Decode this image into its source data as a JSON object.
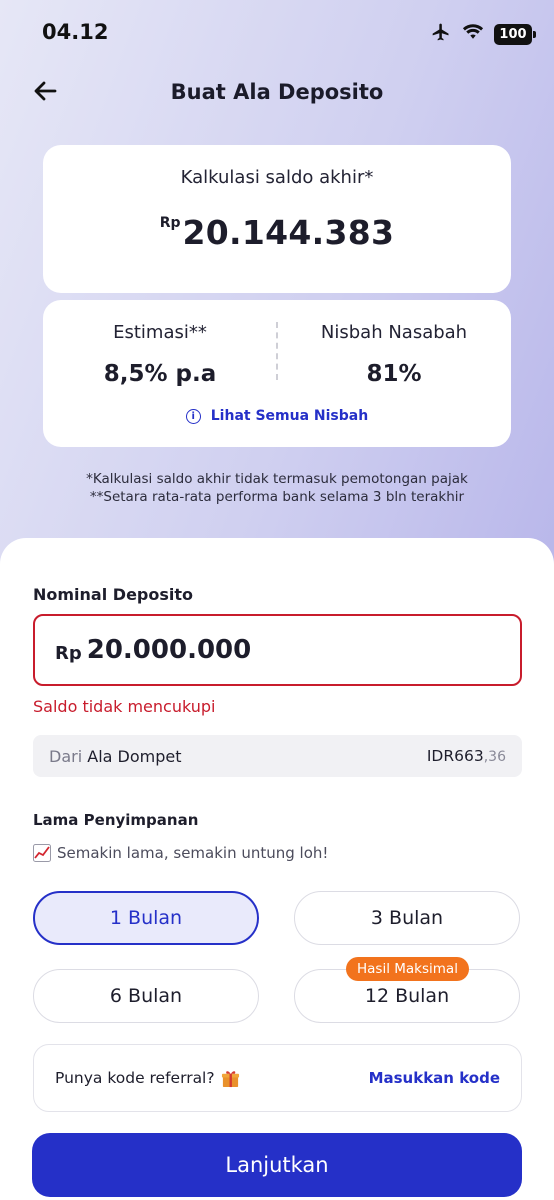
{
  "status_bar": {
    "time": "04.12",
    "battery": "100",
    "icons": [
      "airplane-icon",
      "wifi-icon",
      "battery-icon"
    ]
  },
  "header": {
    "title": "Buat Ala Deposito",
    "back_icon": "arrow-left-icon"
  },
  "summary": {
    "saldo_label": "Kalkulasi saldo akhir*",
    "saldo_currency": "Rp",
    "saldo_value": "20.144.383",
    "estimasi_label": "Estimasi**",
    "estimasi_value": "8,5% p.a",
    "nisbah_label": "Nisbah Nasabah",
    "nisbah_value": "81%",
    "nisbah_link": "Lihat Semua Nisbah"
  },
  "footnotes": {
    "line1": "*Kalkulasi saldo akhir tidak termasuk pemotongan pajak",
    "line2": "**Setara rata-rata performa bank selama 3 bln terakhir"
  },
  "form": {
    "nominal_label": "Nominal Deposito",
    "nominal_currency": "Rp",
    "nominal_value": "20.000.000",
    "error": "Saldo tidak mencukupi",
    "source_prefix": "Dari",
    "source_wallet": "Ala Dompet",
    "source_amount": "IDR663",
    "source_cents": ",36",
    "lama_label": "Lama Penyimpanan",
    "lama_hint": "Semakin lama, semakin untung loh!",
    "durations": [
      "1 Bulan",
      "3 Bulan",
      "6 Bulan",
      "12 Bulan"
    ],
    "selected_duration": "1 Bulan",
    "badge": "Hasil Maksimal",
    "referral_text": "Punya kode referral?",
    "referral_link": "Masukkan kode",
    "submit": "Lanjutkan"
  },
  "colors": {
    "accent": "#2530c8",
    "error": "#c81c2c",
    "badge": "#f2731d"
  }
}
